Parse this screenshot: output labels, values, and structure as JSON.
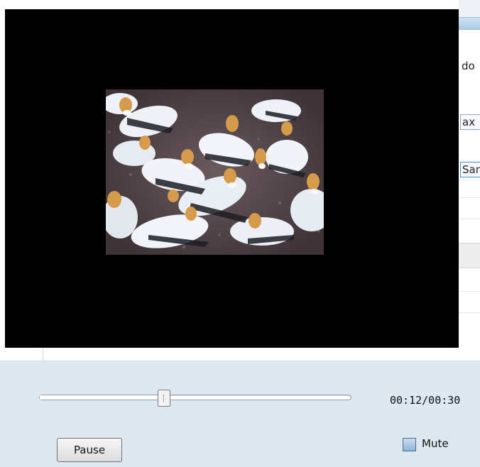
{
  "background_window": {
    "fragments": [
      "do",
      "ax",
      "San"
    ]
  },
  "player": {
    "video_description_icon": "video-frame-birds",
    "seek": {
      "position_fraction": 0.4,
      "time_readout": "00:12/00:30"
    },
    "pause_label": "Pause",
    "mute_label": "Mute",
    "mute_checked": false
  },
  "colors": {
    "video_background": "#000000",
    "control_panel": "#dee8f1"
  }
}
